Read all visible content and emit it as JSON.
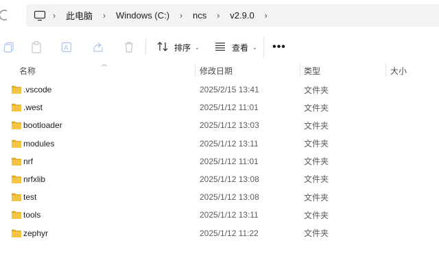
{
  "address": {
    "crumbs": [
      "此电脑",
      "Windows (C:)",
      "ncs",
      "v2.9.0"
    ]
  },
  "toolbar": {
    "sort_label": "排序",
    "view_label": "查看",
    "more_label": "•••"
  },
  "columns": {
    "name": "名称",
    "date": "修改日期",
    "type": "类型",
    "size": "大小"
  },
  "files": [
    {
      "name": ".vscode",
      "date": "2025/2/15 13:41",
      "type": "文件夹"
    },
    {
      "name": ".west",
      "date": "2025/1/12 11:01",
      "type": "文件夹"
    },
    {
      "name": "bootloader",
      "date": "2025/1/12 13:03",
      "type": "文件夹"
    },
    {
      "name": "modules",
      "date": "2025/1/12 13:11",
      "type": "文件夹"
    },
    {
      "name": "nrf",
      "date": "2025/1/12 11:01",
      "type": "文件夹"
    },
    {
      "name": "nrfxlib",
      "date": "2025/1/12 13:08",
      "type": "文件夹"
    },
    {
      "name": "test",
      "date": "2025/1/12 13:08",
      "type": "文件夹"
    },
    {
      "name": "tools",
      "date": "2025/1/12 13:11",
      "type": "文件夹"
    },
    {
      "name": "zephyr",
      "date": "2025/1/12 11:22",
      "type": "文件夹"
    }
  ],
  "colors": {
    "folder": "#f4c542",
    "folder_dark": "#e0a820",
    "address_bg": "#f3f3f3"
  }
}
